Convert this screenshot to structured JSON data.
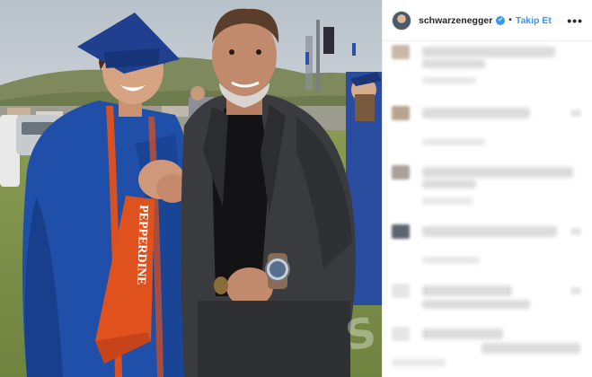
{
  "post": {
    "username": "schwarzenegger",
    "verified_mark": "✔",
    "separator": "•",
    "follow_label": "Takip Et",
    "more_label": "•••",
    "sash_text": "PEPPERDINE"
  },
  "colors": {
    "follow_blue": "#3897f0",
    "gown_blue": "#1f4fa8",
    "stole_orange": "#e0521d",
    "suit_gray": "#3a3b3f"
  },
  "icons": {
    "verified": "verified-badge-icon",
    "more": "more-options-icon"
  },
  "comments_blurred": [
    {
      "avatar_color": "#c9b8a8"
    },
    {
      "avatar_color": "#b9a38f"
    },
    {
      "avatar_color": "#a7a19a"
    },
    {
      "avatar_color": "#5c6470"
    },
    {
      "avatar_color": "#e6e6e6"
    },
    {
      "avatar_color": "#e6e6e6"
    }
  ]
}
